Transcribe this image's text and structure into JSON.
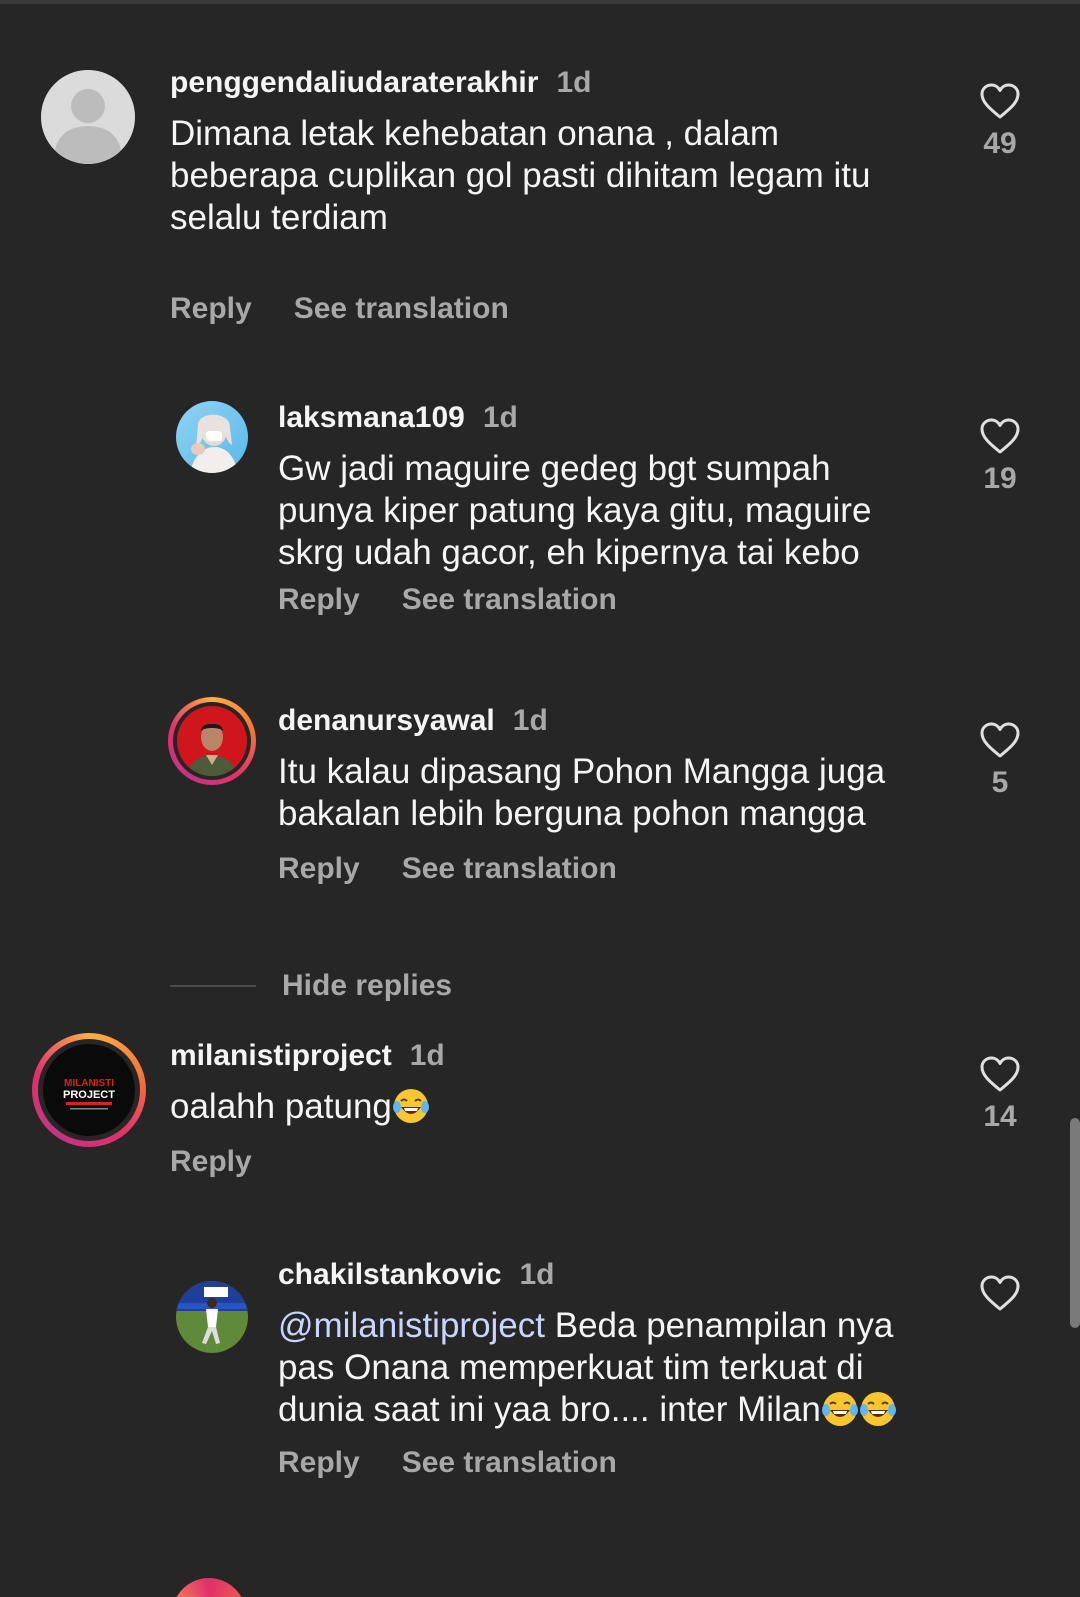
{
  "comments": [
    {
      "username": "penggendaliudaraterakhir",
      "time": "1d",
      "text": "Dimana letak kehebatan onana , dalam beberapa cuplikan gol pasti dihitam legam itu selalu terdiam",
      "reply_label": "Reply",
      "translate_label": "See translation",
      "likes": "49",
      "avatar": "default-avatar-icon"
    },
    {
      "username": "laksmana109",
      "time": "1d",
      "text": "Gw jadi maguire gedeg bgt sumpah punya kiper patung kaya gitu, maguire skrg udah gacor, eh kipernya tai kebo",
      "reply_label": "Reply",
      "translate_label": "See translation",
      "likes": "19",
      "avatar": "photo-avatar"
    },
    {
      "username": "denanursyawal",
      "time": "1d",
      "text": "Itu kalau dipasang Pohon Mangga juga bakalan lebih berguna pohon mangga",
      "reply_label": "Reply",
      "translate_label": "See translation",
      "likes": "5",
      "avatar": "photo-avatar-story-ring"
    },
    {
      "username": "milanistiproject",
      "time": "1d",
      "text": "oalahh patung",
      "reply_label": "Reply",
      "likes": "14",
      "avatar": "logo-avatar-story-ring",
      "logo_text_line1": "MILANISTI",
      "logo_text_line2": "PROJECT"
    },
    {
      "username": "chakilstankovic",
      "time": "1d",
      "mention": "@milanistiproject",
      "text": " Beda penampilan nya pas Onana memperkuat tim terkuat di dunia saat ini yaa bro.... inter Milan",
      "reply_label": "Reply",
      "translate_label": "See translation",
      "likes": "",
      "avatar": "photo-avatar"
    }
  ],
  "hide_replies_label": "Hide replies",
  "colors": {
    "background": "#262626",
    "primary_text": "#f5f5f5",
    "secondary_text": "#a8a8a8",
    "mention": "#c7d6ff"
  }
}
